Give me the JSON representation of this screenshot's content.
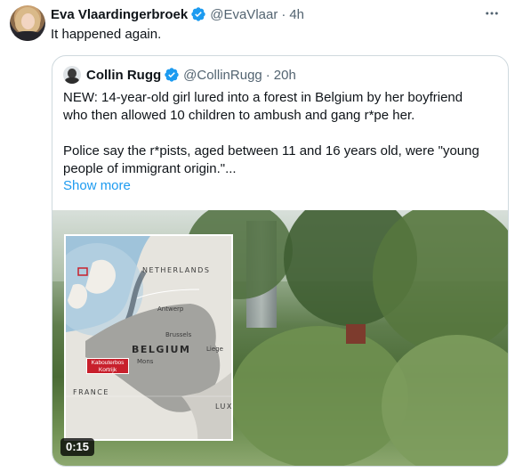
{
  "tweet": {
    "author_name": "Eva Vlaardingerbroek",
    "author_handle": "@EvaVlaar",
    "separator": "·",
    "time": "4h",
    "text": "It happened again.",
    "more_icon": "more-horizontal-icon"
  },
  "quote": {
    "author_name": "Collin Rugg",
    "author_handle": "@CollinRugg",
    "separator": "·",
    "time": "20h",
    "text_line1": "NEW: 14-year-old girl lured into a forest in Belgium by her boyfriend",
    "text_line2": "who then allowed 10 children to ambush and gang r*pe her.",
    "text_line3": "Police say the r*pists, aged between 11 and 16 years old, were \"young",
    "text_line4": "people of immigrant origin.\"...",
    "show_more": "Show more",
    "media": {
      "duration": "0:15",
      "map_labels": {
        "netherlands": "NETHERLANDS",
        "antwerp": "Antwerp",
        "brussels": "Brussels",
        "belgium": "BELGIUM",
        "liege": "Liege",
        "mons": "Mons",
        "france": "FRANCE",
        "lux": "LUX",
        "marker_line1": "Kabouterbos",
        "marker_line2": "Kortrijk"
      }
    }
  },
  "colors": {
    "accent": "#1d9bf0",
    "text": "#0f1419",
    "secondary": "#536471",
    "border": "#cfd9de",
    "marker_red": "#c8202c"
  }
}
